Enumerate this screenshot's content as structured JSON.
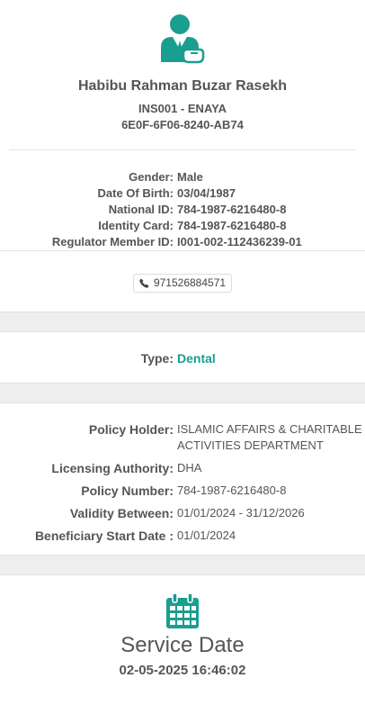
{
  "patient": {
    "name": "Habibu Rahman Buzar Rasekh",
    "insurance_line": "INS001 - ENAYA",
    "uid": "6E0F-6F06-8240-AB74"
  },
  "demographics": {
    "gender_label": "Gender:",
    "gender": "Male",
    "dob_label": "Date Of Birth:",
    "dob": "03/04/1987",
    "national_id_label": "National ID:",
    "national_id": "784-1987-6216480-8",
    "identity_card_label": "Identity Card:",
    "identity_card": "784-1987-6216480-8",
    "regulator_label": "Regulator Member ID:",
    "regulator_id": "I001-002-112436239-01"
  },
  "contact": {
    "phone": "971526884571",
    "phone_icon": "phone-icon"
  },
  "type": {
    "label": "Type:",
    "value": "Dental"
  },
  "policy": {
    "holder_label": "Policy Holder:",
    "holder": "ISLAMIC AFFAIRS & CHARITABLE ACTIVITIES DEPARTMENT",
    "authority_label": "Licensing Authority:",
    "authority": "DHA",
    "number_label": "Policy Number:",
    "number": "784-1987-6216480-8",
    "validity_label": "Validity Between:",
    "validity": "01/01/2024 - 31/12/2026",
    "start_label": "Beneficiary Start Date :",
    "start": "01/01/2024"
  },
  "service": {
    "title": "Service Date",
    "datetime": "02-05-2025 16:46:02",
    "icon": "calendar-icon"
  },
  "colors": {
    "accent": "#1a9e8f",
    "text": "#555555",
    "band": "#eeeeee"
  }
}
